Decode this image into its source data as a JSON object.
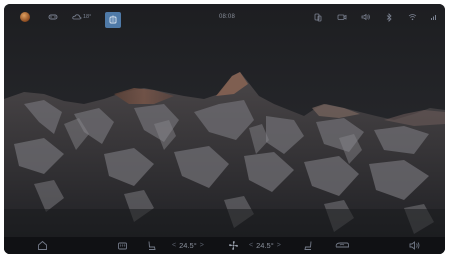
{
  "status_bar": {
    "time": "08:08",
    "weather_temp": "18°",
    "icons": [
      "avatar",
      "car-link-icon",
      "weather-icon",
      "active-app-icon",
      "bluetooth-phone-icon",
      "dashcam-icon",
      "volume-icon",
      "bluetooth-icon",
      "wifi-icon",
      "signal-icon"
    ]
  },
  "dock": {
    "left_temp": "24.5°",
    "right_temp": "24.5°",
    "left_chevron": "<",
    "right_chevron": ">",
    "icons": [
      "home-icon",
      "defrost-icon",
      "driver-seat-icon",
      "fan-icon",
      "passenger-seat-icon",
      "recirculation-icon",
      "volume-icon"
    ]
  },
  "colors": {
    "active_tile": "#4f7aa8",
    "dock_background": "#101114",
    "icon_gray": "#737a88"
  }
}
